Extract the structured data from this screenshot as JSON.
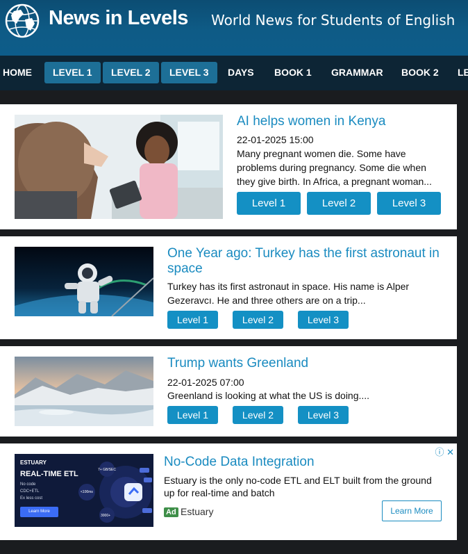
{
  "header": {
    "brand": "News in Levels",
    "tagline": "World News for Students of English"
  },
  "nav": {
    "items": [
      "HOME",
      "LEVEL 1",
      "LEVEL 2",
      "LEVEL 3",
      "DAYS",
      "BOOK 1",
      "GRAMMAR",
      "BOOK 2",
      "LE"
    ]
  },
  "articles": [
    {
      "title": "AI helps women in Kenya",
      "date": "22-01-2025 15:00",
      "excerpt": "Many pregnant women die. Some have problems during pregnancy. Some die when they give birth. In Africa, a pregnant woman...",
      "levels": [
        "Level 1",
        "Level 2",
        "Level 3"
      ]
    },
    {
      "title": "One Year ago: Turkey has the first astronaut in space",
      "date": "",
      "excerpt": "Turkey has its first astronaut in space. His name is Alper Gezeravcı. He and three others are on a trip...",
      "levels": [
        "Level 1",
        "Level 2",
        "Level 3"
      ]
    },
    {
      "title": "Trump wants Greenland",
      "date": "22-01-2025 07:00",
      "excerpt": "Greenland is looking at what the US is doing....",
      "levels": [
        "Level 1",
        "Level 2",
        "Level 3"
      ]
    }
  ],
  "ad": {
    "title": "No-Code Data Integration",
    "text": "Estuary is the only no-code ETL and ELT built from the ground up for real-time and batch",
    "badge": "Ad",
    "sponsor": "Estuary",
    "cta": "Learn More",
    "image": {
      "brand": "ESTUARY",
      "headline": "REAL-TIME ETL",
      "bullets": [
        "No code",
        "CDC+ETL",
        "Ex less cost"
      ],
      "button": "Learn More",
      "stats": [
        "7+ GB/SEC",
        "<100ms",
        "3000+"
      ]
    },
    "icons": [
      "info-icon",
      "close-icon"
    ]
  },
  "colors": {
    "header": "#0e5b86",
    "nav": "#0d2535",
    "level_tab": "#1d6f97",
    "link": "#1a8bc0",
    "button": "#1490c4"
  }
}
